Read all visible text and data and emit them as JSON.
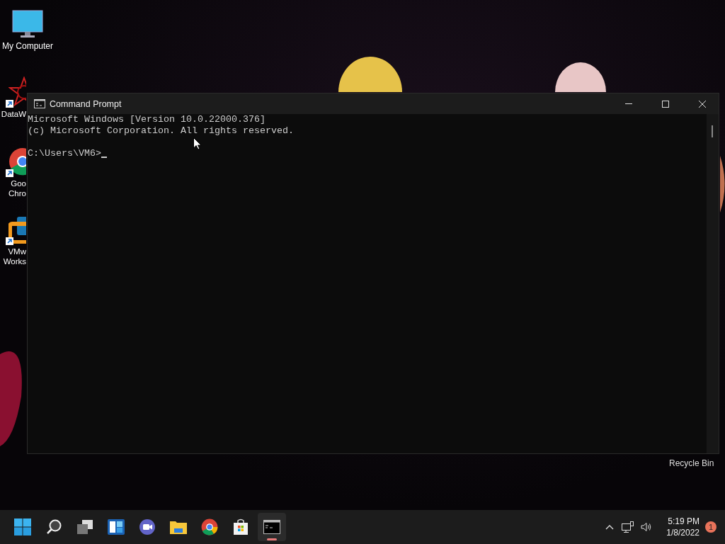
{
  "desktop": {
    "icons": [
      {
        "kind": "computer",
        "lines": [
          "My Computer"
        ]
      },
      {
        "kind": "star",
        "lines": [
          "DataW"
        ],
        "shortcut": true
      },
      {
        "kind": "browser",
        "lines": [
          "Goo",
          "Chro"
        ],
        "shortcut": true
      },
      {
        "kind": "vm",
        "lines": [
          "VMw",
          "Works"
        ],
        "shortcut": true
      }
    ],
    "recycle_bin": "Recycle Bin"
  },
  "window": {
    "title": "Command Prompt",
    "lines": [
      "Microsoft Windows [Version 10.0.22000.376]",
      "(c) Microsoft Corporation. All rights reserved."
    ],
    "prompt": "C:\\Users\\VM6>"
  },
  "taskbar": {
    "apps": [
      {
        "kind": "start",
        "selected": false
      },
      {
        "kind": "search",
        "selected": false
      },
      {
        "kind": "taskview",
        "selected": false
      },
      {
        "kind": "widgets",
        "selected": false
      },
      {
        "kind": "chat",
        "selected": false
      },
      {
        "kind": "folder",
        "selected": false
      },
      {
        "kind": "browser",
        "selected": false
      },
      {
        "kind": "store",
        "selected": false
      },
      {
        "kind": "terminal",
        "selected": true
      }
    ],
    "time": "5:19 PM",
    "date": "1/8/2022",
    "notifications": "1"
  }
}
